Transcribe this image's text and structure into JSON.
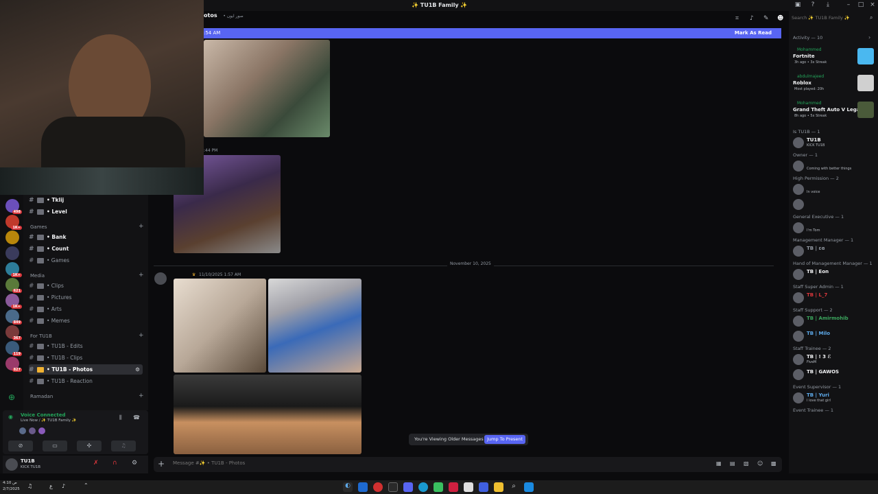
{
  "window": {
    "title": "✨ TU1B Family ✨"
  },
  "header": {
    "channel_name": "otos",
    "subtitle": "• صور ايون"
  },
  "banner": {
    "text_left": ":54 AM",
    "mark_read": "Mark As Read"
  },
  "messages": {
    "time_1": ":44 PM",
    "date_divider": "November 10, 2025",
    "time_2": "11/10/2025 1:57 AM",
    "older_notice": "You're Viewing Older Messages",
    "jump_label": "Jump To Present"
  },
  "composer": {
    "placeholder": "Message #✨ • TU1B - Photos"
  },
  "channels": {
    "top": [
      {
        "label": "• Tklij",
        "bold": true
      },
      {
        "label": "• Level",
        "bold": true
      }
    ],
    "cat_games": "Games",
    "games": [
      {
        "label": "• Bank",
        "bold": true
      },
      {
        "label": "• Count",
        "bold": true
      },
      {
        "label": "• Games",
        "bold": false
      }
    ],
    "cat_media": "Media",
    "media": [
      {
        "label": "• Clips"
      },
      {
        "label": "• Pictures"
      },
      {
        "label": "• Arts"
      },
      {
        "label": "• Memes"
      }
    ],
    "cat_fortu1b": "For TU1B",
    "fortu1b": [
      {
        "label": "• TU1B - Edits",
        "active": false
      },
      {
        "label": "• TU1B - Clips",
        "active": false
      },
      {
        "label": "• TU1B - Photos",
        "active": true
      },
      {
        "label": "• TU1B - Reaction",
        "active": false
      }
    ],
    "cat_ramadan": "Ramadan"
  },
  "voice": {
    "status": "Voice Connected",
    "channel": "Live Now / ✨ TU1B Family ✨"
  },
  "user": {
    "name": "TU1B",
    "status": "KICK TU1B"
  },
  "servers": [
    {
      "badge": "498",
      "color": "#6b4fbb"
    },
    {
      "badge": "1K+",
      "color": "#c0392b"
    },
    {
      "badge": "",
      "color": "#b8860b"
    },
    {
      "badge": "",
      "color": "#3a3b5c"
    },
    {
      "badge": "1K+",
      "color": "#2d7d9a"
    },
    {
      "badge": "621",
      "color": "#5a7a3a"
    },
    {
      "badge": "1K+",
      "color": "#8a5a9a"
    },
    {
      "badge": "849",
      "color": "#4a6a8a"
    },
    {
      "badge": "367",
      "color": "#7a3a3a"
    },
    {
      "badge": "119",
      "color": "#3a5a7a"
    },
    {
      "badge": "827",
      "color": "#9a3a6a"
    }
  ],
  "right": {
    "search_placeholder": "Search ✨ TU1B Family ✨",
    "activity_header": "Activity — 10",
    "activities": [
      {
        "user": "Mohammed",
        "game": "Fortnite",
        "time": "3h ago • 3x Streak",
        "color": "#4ab8f0"
      },
      {
        "user": "abdulmajeed",
        "game": "Roblox",
        "time": "Most played: 20h",
        "color": "#d0d0d0"
      },
      {
        "user": "Mohammed",
        "game": "Grand Theft Auto V Legacy",
        "time": "8h ago • 5x Streak",
        "color": "#4a5a3a"
      }
    ],
    "sections": [
      {
        "title": "Is TU1B — 1",
        "members": [
          {
            "name": "TU1B",
            "status": "KICK TU1B",
            "color": "#f2f3f5"
          }
        ]
      },
      {
        "title": "Owner — 1",
        "members": [
          {
            "name": "",
            "status": "Coming with better things",
            "color": "#da373c"
          }
        ]
      },
      {
        "title": "High Permission — 2",
        "members": [
          {
            "name": "",
            "status": "In voice",
            "color": "#da373c"
          },
          {
            "name": "",
            "status": "",
            "color": "#da373c"
          }
        ]
      },
      {
        "title": "General Executive — 1",
        "members": [
          {
            "name": "",
            "status": "I'm Tom",
            "color": "#da373c"
          }
        ]
      },
      {
        "title": "Management Manager — 1",
        "members": [
          {
            "name": "TB | ɛɞ",
            "status": "",
            "color": "#949ba4"
          }
        ]
      },
      {
        "title": "Hand of Management Manager — 1",
        "members": [
          {
            "name": "TB | Eon",
            "status": "",
            "color": "#f2f3f5"
          }
        ]
      },
      {
        "title": "Staff Super Admin — 1",
        "members": [
          {
            "name": "TB | L_7",
            "status": "",
            "color": "#da373c"
          }
        ]
      },
      {
        "title": "Staff Support — 2",
        "members": [
          {
            "name": "TB | Amirmohib",
            "status": "",
            "color": "#3ba55d"
          },
          {
            "name": "TB | Milo",
            "status": "",
            "color": "#5da9e9"
          }
        ]
      },
      {
        "title": "Staff Trainee — 2",
        "members": [
          {
            "name": "TB | ! 3 ℰ",
            "status": "FiveM",
            "color": "#f2f3f5"
          },
          {
            "name": "TB | GAWOS",
            "status": "",
            "color": "#f2f3f5"
          }
        ]
      },
      {
        "title": "Event Supervisor — 1",
        "members": [
          {
            "name": "TB | Yuri",
            "status": "I love that girl",
            "color": "#5da9e9"
          }
        ]
      },
      {
        "title": "Event Trainee — 1",
        "members": []
      }
    ]
  },
  "taskbar": {
    "time": "4:10 ص",
    "date": "2/7/2025",
    "lang": "ع"
  }
}
